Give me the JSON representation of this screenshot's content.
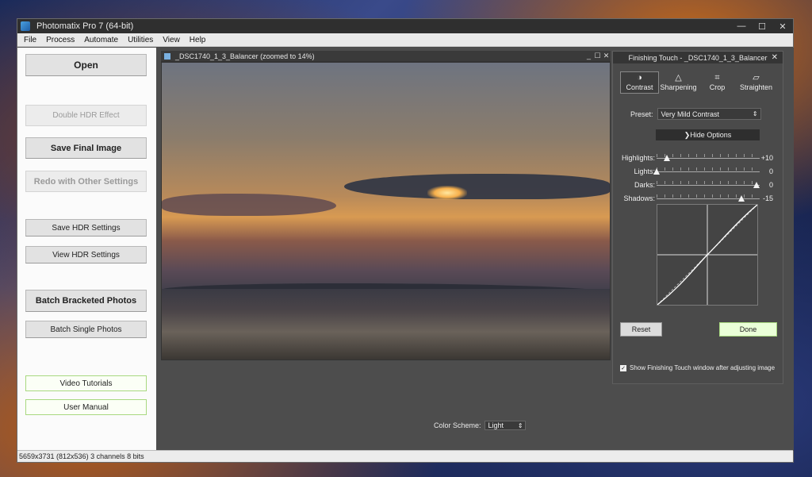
{
  "window": {
    "title": "Photomatix Pro 7  (64-bit)",
    "controls": [
      "—",
      "☐",
      "✕"
    ]
  },
  "menu": [
    "File",
    "Process",
    "Automate",
    "Utilities",
    "View",
    "Help"
  ],
  "left_panel": {
    "open": "Open",
    "double_hdr": "Double HDR Effect",
    "save_final": "Save Final Image",
    "redo": "Redo with Other Settings",
    "save_hdr_settings": "Save HDR Settings",
    "view_hdr_settings": "View HDR Settings",
    "batch_bracketed": "Batch Bracketed Photos",
    "batch_single": "Batch Single Photos",
    "video_tutorials": "Video Tutorials",
    "user_manual": "User Manual"
  },
  "image_window": {
    "title": "_DSC1740_1_3_Balancer (zoomed to 14%)",
    "controls": [
      "_",
      "☐",
      "✕"
    ]
  },
  "color_scheme": {
    "label": "Color Scheme:",
    "value": "Light"
  },
  "finishing_touch": {
    "title": "Finishing Touch - _DSC1740_1_3_Balancer",
    "close": "✕",
    "tabs": [
      {
        "label": "Contrast",
        "icon": "◑"
      },
      {
        "label": "Sharpening",
        "icon": "△"
      },
      {
        "label": "Crop",
        "icon": "⌗"
      },
      {
        "label": "Straighten",
        "icon": "▱"
      }
    ],
    "preset_label": "Preset:",
    "preset_value": "Very Mild Contrast",
    "hide_options": "❯Hide Options",
    "sliders": [
      {
        "label": "Highlights:",
        "value": "+10",
        "level": 0.1
      },
      {
        "label": "Lights:",
        "value": "0",
        "level": 0.0
      },
      {
        "label": "Darks:",
        "value": "0",
        "level": 1.0
      },
      {
        "label": "Shadows:",
        "value": "-15",
        "level": 0.85
      }
    ],
    "reset": "Reset",
    "done": "Done",
    "show_checkbox": "Show Finishing Touch window after adjusting image",
    "show_checked": true
  },
  "status": "5659x3731 (812x536) 3 channels 8 bits"
}
